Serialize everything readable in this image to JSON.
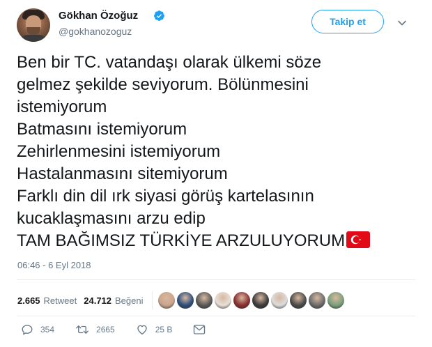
{
  "user": {
    "display_name": "Gökhan Özoğuz",
    "handle": "@gokhanozoguz",
    "verified": true
  },
  "follow_button_label": "Takip et",
  "tweet": {
    "text": "Ben bir TC. vatandaşı olarak ülkemi söze\ngelmez şekilde seviyorum. Bölünmesini\nistemiyorum\nBatmasını istemiyorum\nZehirlenmesini istemiyorum\nHastalanmasını sitemiyorum\nFarklı din dil ırk siyasi görüş kartelasının\nkucaklaşmasını arzu edip\nTAM BAĞIMSIZ TÜRKİYE ARZULUYORUM",
    "emoji": "turkey-flag",
    "timestamp": "06:46 - 6 Eyl 2018"
  },
  "stats": {
    "retweet_count": "2.665",
    "retweet_label": "Retweet",
    "like_count": "24.712",
    "like_label": "Beğeni"
  },
  "likers": [
    {
      "icon": "liker-avatar-1",
      "color": "#c9a58c"
    },
    {
      "icon": "liker-avatar-2",
      "color": "#2d4f7c"
    },
    {
      "icon": "liker-avatar-3",
      "color": "#5a5a5a"
    },
    {
      "icon": "liker-avatar-4",
      "color": "#e8e0d8"
    },
    {
      "icon": "liker-avatar-5",
      "color": "#8a3030"
    },
    {
      "icon": "liker-avatar-6",
      "color": "#3c3c3c"
    },
    {
      "icon": "liker-avatar-7",
      "color": "#dcdcdc"
    },
    {
      "icon": "liker-avatar-8",
      "color": "#4a4a4a"
    },
    {
      "icon": "liker-avatar-9",
      "color": "#6c6c6c"
    },
    {
      "icon": "liker-avatar-10",
      "color": "#7aa07a"
    }
  ],
  "actions": {
    "reply_count": "354",
    "retweet_count": "2665",
    "like_count": "25 B"
  },
  "colors": {
    "accent": "#1da1f2",
    "secondary_text": "#657786",
    "primary_text": "#14171a",
    "divider": "#e6ecf0"
  }
}
